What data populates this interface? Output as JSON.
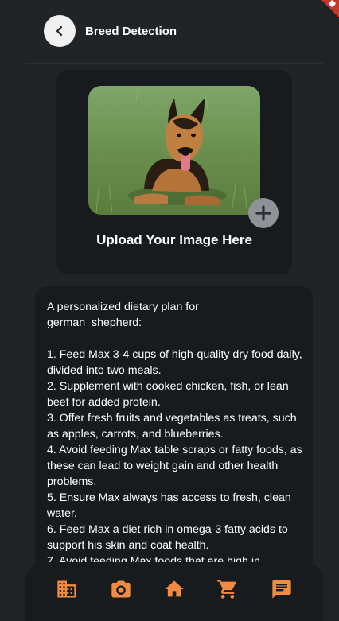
{
  "header": {
    "title": "Breed Detection",
    "back_icon": "chevron-left-icon"
  },
  "upload": {
    "label": "Upload Your Image Here",
    "add_icon": "plus-icon"
  },
  "plan": {
    "text": "A personalized dietary plan for\ngerman_shepherd:\n\n1. Feed Max 3-4 cups of high-quality dry food daily, divided into two meals.\n2. Supplement with cooked chicken, fish, or lean beef for added protein.\n3. Offer fresh fruits and vegetables as treats, such as apples, carrots, and blueberries.\n4. Avoid feeding Max table scraps or fatty foods, as these can lead to weight gain and other health problems.\n5. Ensure Max always has access to fresh, clean water.\n6. Feed Max a diet rich in omega-3 fatty acids to support his skin and coat health.\n7. Avoid feeding Max foods that are high in"
  },
  "nav": {
    "items": [
      "building-icon",
      "camera-icon",
      "home-icon",
      "cart-icon",
      "chat-icon"
    ]
  },
  "colors": {
    "background": "#202427",
    "card": "#181b1d",
    "accent": "#f28b40"
  }
}
